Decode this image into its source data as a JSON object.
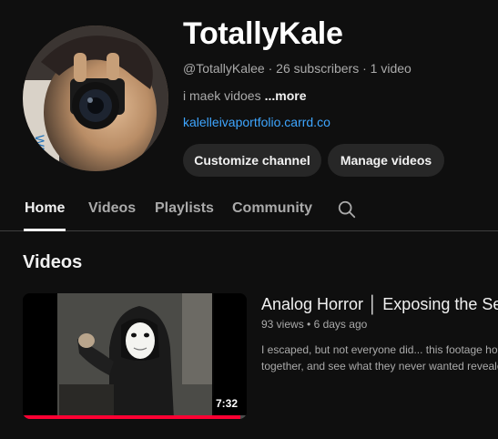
{
  "channel": {
    "name": "TotallyKale",
    "handle": "@TotallyKalee",
    "subscribers": "26 subscribers",
    "video_count": "1 video",
    "description": "i maek vidoes",
    "more_label": "...more",
    "link": "kalelleivaportfolio.carrd.co",
    "avatar_icon": "avatar-camera-photo"
  },
  "buttons": {
    "customize": "Customize channel",
    "manage": "Manage videos"
  },
  "tabs": [
    {
      "label": "Home",
      "active": true
    },
    {
      "label": "Videos",
      "active": false
    },
    {
      "label": "Playlists",
      "active": false
    },
    {
      "label": "Community",
      "active": false
    }
  ],
  "search_icon": "search-icon",
  "section": {
    "title": "Videos"
  },
  "video": {
    "title": "Analog Horror │ Exposing the Se",
    "views": "93 views",
    "age": "6 days ago",
    "description_line1": "I escaped, but not everyone did... this footage hol",
    "description_line2": "together, and see what they never wanted reveale",
    "duration": "7:32",
    "watched_fraction": 0.97
  },
  "colors": {
    "background": "#0f0f0f",
    "link": "#3ea6ff",
    "button_bg": "#272727",
    "progress": "#ff0033"
  }
}
